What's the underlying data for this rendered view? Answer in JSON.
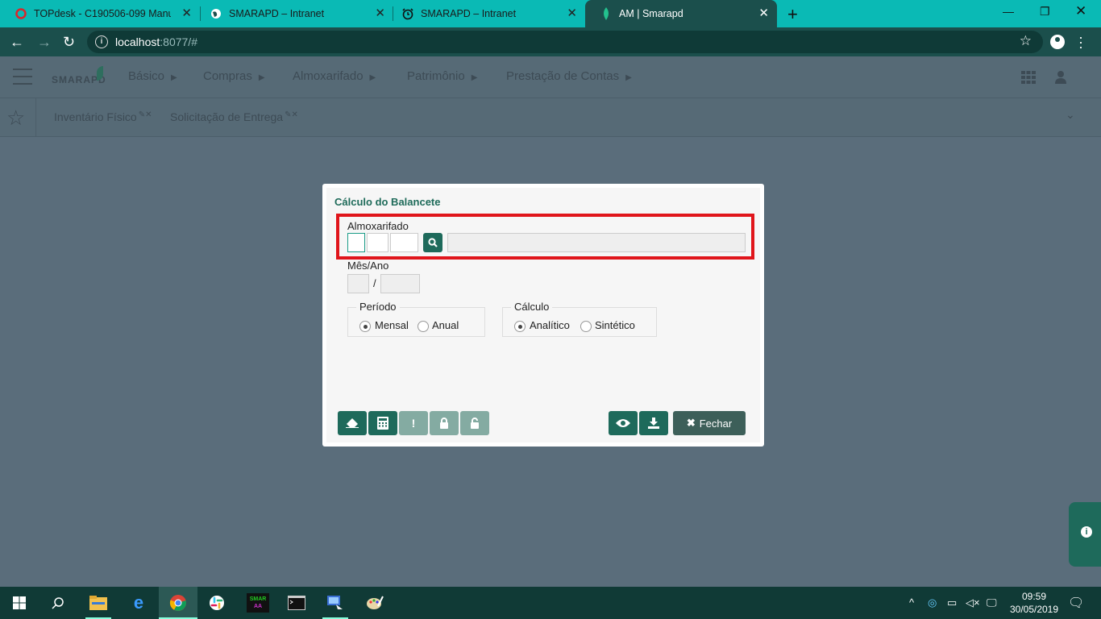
{
  "browser": {
    "tabs": [
      {
        "title": "TOPdesk - C190506-099 Manual",
        "icon": "topdesk-icon"
      },
      {
        "title": "SMARAPD – Intranet",
        "icon": "globe-icon"
      },
      {
        "title": "SMARAPD – Intranet",
        "icon": "alarm-clock-icon"
      },
      {
        "title": "AM | Smarapd",
        "icon": "smarapd-leaf-icon",
        "active": true
      }
    ],
    "url_host": "localhost",
    "url_rest": ":8077/#"
  },
  "app": {
    "logo": "SMARAPD",
    "nav": [
      "Básico",
      "Compras",
      "Almoxarifado",
      "Patrimônio",
      "Prestação de Contas"
    ],
    "favorites": [
      "Inventário Físico",
      "Solicitação de Entrega"
    ]
  },
  "dialog": {
    "title": "Cálculo do Balancete",
    "almoxarifado_label": "Almoxarifado",
    "mes_ano_label": "Mês/Ano",
    "mes_ano_sep": "/",
    "periodo": {
      "legend": "Período",
      "options": [
        "Mensal",
        "Anual"
      ],
      "selected": "Mensal"
    },
    "calculo": {
      "legend": "Cálculo",
      "options": [
        "Analítico",
        "Sintético"
      ],
      "selected": "Analítico"
    },
    "close_label": "Fechar"
  },
  "taskbar": {
    "time": "09:59",
    "date": "30/05/2019"
  },
  "colors": {
    "accent": "#1e6a5b",
    "highlight": "#e0151b",
    "chrome": "#0abab5"
  }
}
